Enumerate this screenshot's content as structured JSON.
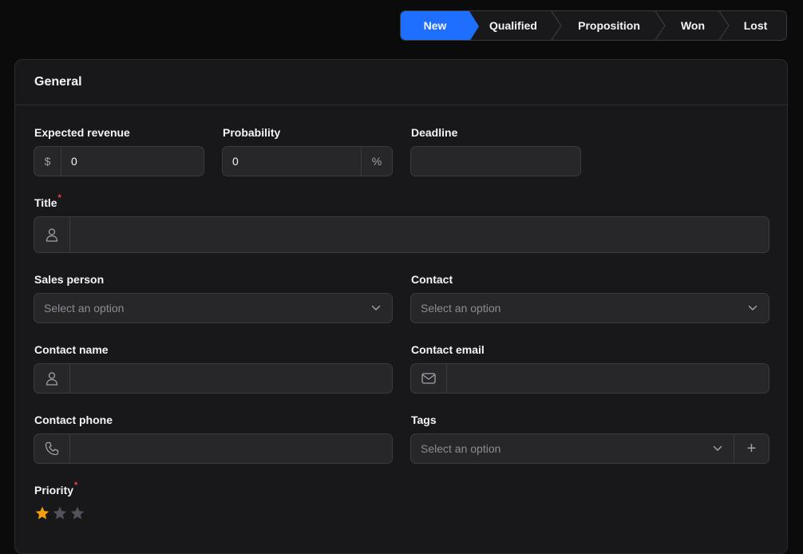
{
  "pipeline": {
    "stages": [
      "New",
      "Qualified",
      "Proposition",
      "Won",
      "Lost"
    ],
    "active_stage": "New"
  },
  "section": {
    "title": "General"
  },
  "fields": {
    "expected_revenue": {
      "label": "Expected revenue",
      "prefix": "$",
      "value": "0"
    },
    "probability": {
      "label": "Probability",
      "suffix": "%",
      "value": "0"
    },
    "deadline": {
      "label": "Deadline",
      "value": ""
    },
    "title": {
      "label": "Title",
      "required_mark": "*",
      "value": ""
    },
    "sales_person": {
      "label": "Sales person",
      "placeholder": "Select an option"
    },
    "contact": {
      "label": "Contact",
      "placeholder": "Select an option"
    },
    "contact_name": {
      "label": "Contact name",
      "value": ""
    },
    "contact_email": {
      "label": "Contact email",
      "value": ""
    },
    "contact_phone": {
      "label": "Contact phone",
      "value": ""
    },
    "tags": {
      "label": "Tags",
      "placeholder": "Select an option",
      "add_symbol": "+"
    },
    "priority": {
      "label": "Priority",
      "required_mark": "*",
      "rating": 1,
      "max": 3
    }
  },
  "colors": {
    "accent": "#1f6fff",
    "star_on": "#f59e0b",
    "star_off": "#52525b",
    "required": "#ef4444"
  },
  "icons": {
    "title_prefix": "user-icon",
    "contact_name_prefix": "user-icon",
    "contact_email_prefix": "mail-icon",
    "contact_phone_prefix": "phone-icon",
    "select_caret": "chevron-down-icon",
    "priority": "star-icon"
  }
}
